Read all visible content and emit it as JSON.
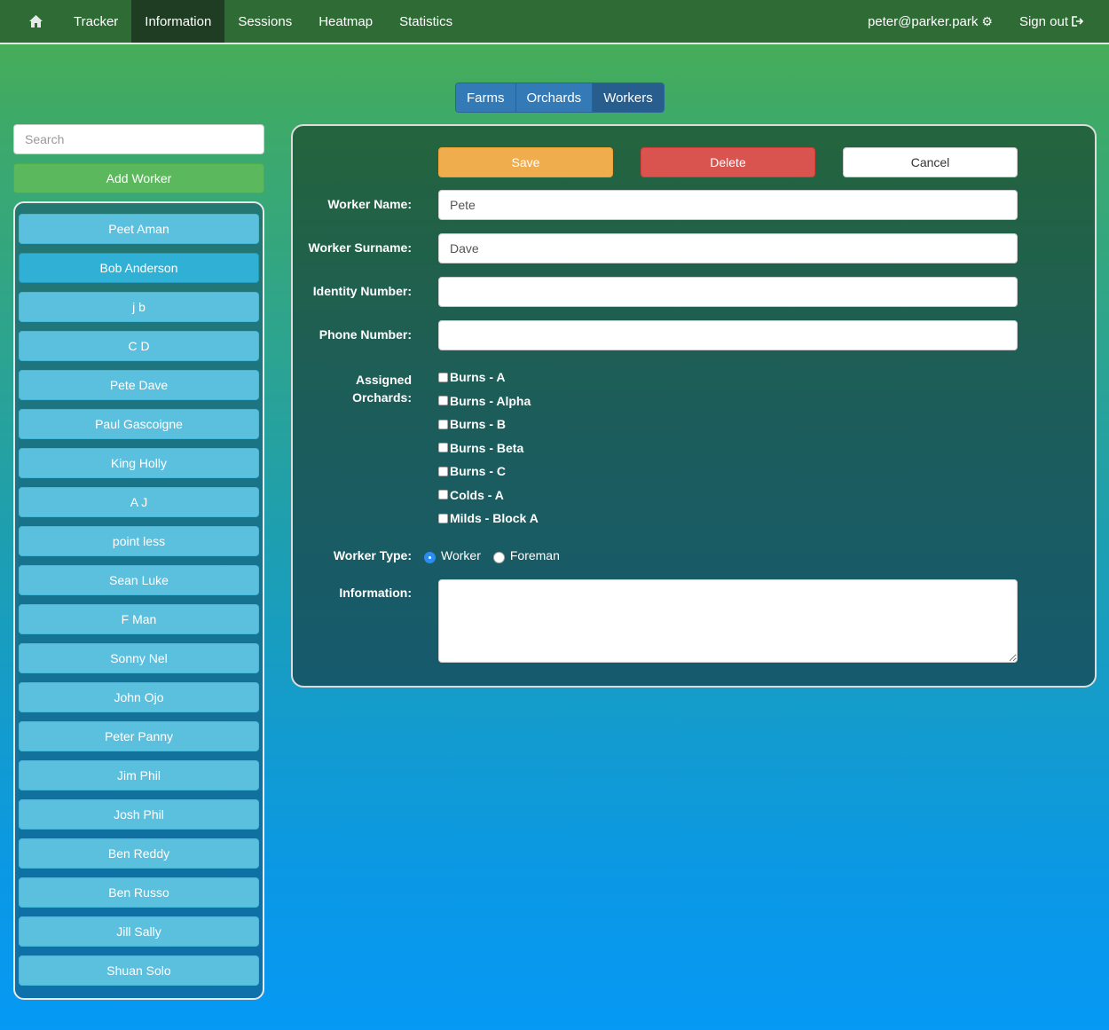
{
  "navbar": {
    "home_icon": "home-icon",
    "items": [
      {
        "label": "Tracker",
        "active": false
      },
      {
        "label": "Information",
        "active": true
      },
      {
        "label": "Sessions",
        "active": false
      },
      {
        "label": "Heatmap",
        "active": false
      },
      {
        "label": "Statistics",
        "active": false
      }
    ],
    "user_email": "peter@parker.park",
    "sign_out_label": "Sign out"
  },
  "tabs": [
    {
      "label": "Farms",
      "active": false
    },
    {
      "label": "Orchards",
      "active": false
    },
    {
      "label": "Workers",
      "active": true
    }
  ],
  "search": {
    "placeholder": "Search"
  },
  "add_worker_label": "Add Worker",
  "workers": [
    "Peet Aman",
    "Bob Anderson",
    "j b",
    "C D",
    "Pete Dave",
    "Paul Gascoigne",
    "King Holly",
    "A J",
    "point less",
    "Sean Luke",
    "F Man",
    "Sonny Nel",
    "John Ojo",
    "Peter Panny",
    "Jim Phil",
    "Josh Phil",
    "Ben Reddy",
    "Ben Russo",
    "Jill Sally",
    "Shuan Solo"
  ],
  "selected_worker": "Bob Anderson",
  "form": {
    "save_label": "Save",
    "delete_label": "Delete",
    "cancel_label": "Cancel",
    "name_label": "Worker Name:",
    "name_value": "Pete",
    "surname_label": "Worker Surname:",
    "surname_value": "Dave",
    "identity_label": "Identity Number:",
    "identity_value": "",
    "phone_label": "Phone Number:",
    "phone_value": "",
    "orchards_label_line1": "Assigned",
    "orchards_label_line2": "Orchards:",
    "orchards": [
      "Burns - A",
      "Burns - Alpha",
      "Burns - B",
      "Burns - Beta",
      "Burns - C",
      "Colds - A",
      "Milds - Block A"
    ],
    "type_label": "Worker Type:",
    "type_options": [
      "Worker",
      "Foreman"
    ],
    "type_selected": "Worker",
    "info_label": "Information:",
    "info_value": ""
  },
  "colors": {
    "navbar": "#2e6b35",
    "save": "#f0ad4e",
    "delete": "#d9534f",
    "add": "#5cb85c",
    "worker_btn": "#5bc0de",
    "tab": "#337ab7"
  }
}
